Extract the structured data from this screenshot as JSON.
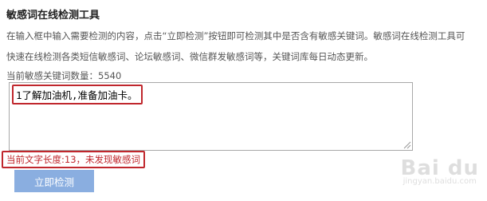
{
  "page": {
    "title": "敏感词在线检测工具",
    "description_line1": "在输入框中输入需要检测的内容，点击“立即检测”按钮即可检测其中是否含有敏感关键词。敏感词在线检测工具可",
    "description_line2": "快速在线检测各类短信敏感词、论坛敏感词、微信群发敏感词等，关键词库每日动态更新。",
    "count_text": "当前敏感关键词数量：5540"
  },
  "editor": {
    "value": "1了解加油机,准备加油卡。",
    "status": "当前文字长度:13，未发现敏感词"
  },
  "actions": {
    "check_button": "立即检测"
  },
  "watermark": {
    "logo": "Bai du",
    "sub": "jingyan.baidu.com"
  },
  "colors": {
    "accent_red": "#c0272d",
    "button_blue": "#8aaee0"
  }
}
